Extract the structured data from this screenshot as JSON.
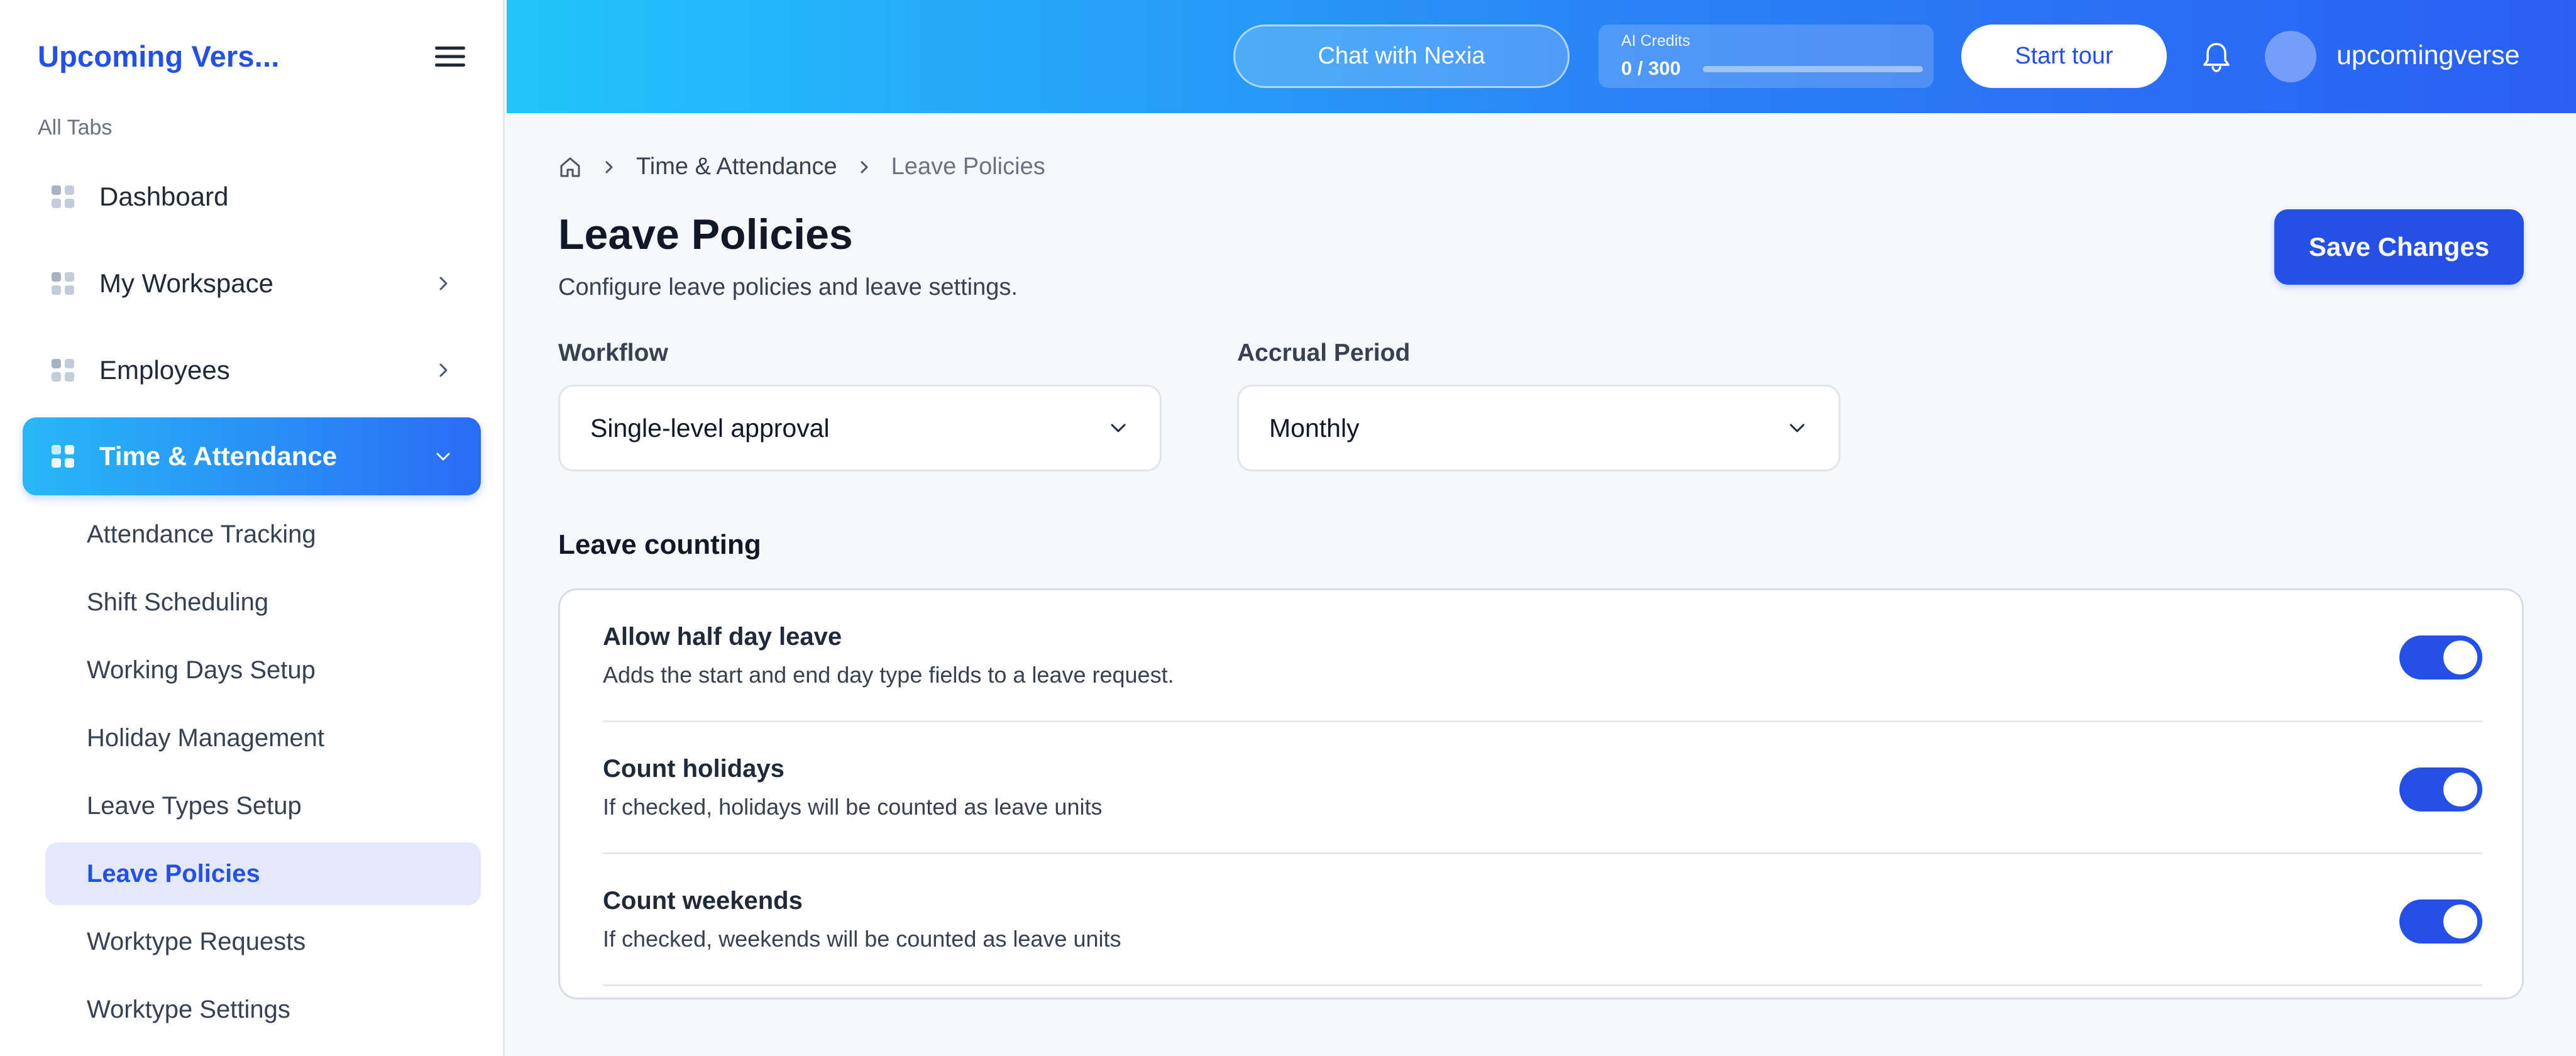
{
  "sidebar": {
    "brand": "Upcoming Vers...",
    "section_label": "All Tabs",
    "nav": [
      {
        "label": "Dashboard"
      },
      {
        "label": "My Workspace"
      },
      {
        "label": "Employees"
      },
      {
        "label": "Time & Attendance"
      }
    ],
    "sub_items": [
      {
        "label": "Attendance Tracking"
      },
      {
        "label": "Shift Scheduling"
      },
      {
        "label": "Working Days Setup"
      },
      {
        "label": "Holiday Management"
      },
      {
        "label": "Leave Types Setup"
      },
      {
        "label": "Leave Policies"
      },
      {
        "label": "Worktype Requests"
      },
      {
        "label": "Worktype Settings"
      }
    ]
  },
  "topbar": {
    "chat_label": "Chat with Nexia",
    "credits_label": "AI Credits",
    "credits_value": "0 / 300",
    "credits_fraction": 0,
    "tour_label": "Start tour",
    "username": "upcomingverse"
  },
  "breadcrumb": {
    "section": "Time & Attendance",
    "current": "Leave Policies"
  },
  "page": {
    "title": "Leave Policies",
    "subtitle": "Configure leave policies and leave settings.",
    "save_label": "Save Changes"
  },
  "form": {
    "workflow_label": "Workflow",
    "workflow_value": "Single-level approval",
    "accrual_label": "Accrual Period",
    "accrual_value": "Monthly"
  },
  "leave_counting": {
    "title": "Leave counting",
    "rows": [
      {
        "title": "Allow half day leave",
        "desc": "Adds the start and end day type fields to a leave request.",
        "enabled": true
      },
      {
        "title": "Count holidays",
        "desc": "If checked, holidays will be counted as leave units",
        "enabled": true
      },
      {
        "title": "Count weekends",
        "desc": "If checked, weekends will be counted as leave units",
        "enabled": true
      }
    ]
  },
  "colors": {
    "accent": "#2450e8",
    "topbar_start": "#22c5fb",
    "topbar_end": "#2a5ff3"
  }
}
